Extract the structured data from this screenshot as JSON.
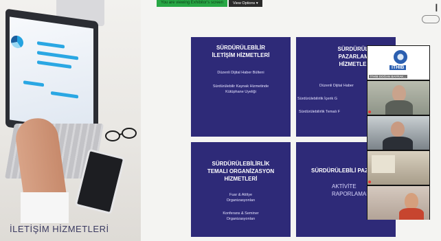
{
  "toolbar": {
    "share_status": "You are viewing Exhibitor's screen",
    "view_options": "View Options ▾"
  },
  "caption": "İLETİŞİM HİZMETLERİ",
  "panels": [
    {
      "title": "SÜRDÜRÜLEBİLİR İLETİŞİM HİZMETLERİ",
      "items": [
        "Düzenli Dijital Haber Bülteni",
        "Sürdürülebilir Kaynak Hizmetinde Kütüphane Uyeliği"
      ]
    },
    {
      "title": "SÜRDÜRÜLEBİ PAZARLAMA HİZMETLERİ",
      "items": [
        "Düzenli Dijital Haber",
        "Sürdürülebilirlik İçerik G",
        "Sürdürülebilirlik Temalı F"
      ]
    },
    {
      "title": "SÜRDÜRÜLEBİLİRLİK TEMALI ORGANİZASYON HİZMETLERİ",
      "items": [
        "Fuar & Atölye Organizasyonları",
        "Konferans & Seminer Organizasyonları"
      ]
    },
    {
      "title": "SÜRDÜRÜLEBİLİ PAZARLAMA ve İLE",
      "items": [
        "AKTİVİTE RAPORLAMALA"
      ]
    }
  ],
  "gallery": {
    "logo_text": "İTHİB",
    "participants": [
      "İTHİB DOĞAN BAYRAK...",
      "",
      "",
      "",
      ""
    ]
  },
  "colors": {
    "panel_bg": "#2e2a78",
    "share_green": "#27a745",
    "caption_text": "#3a3a60"
  }
}
